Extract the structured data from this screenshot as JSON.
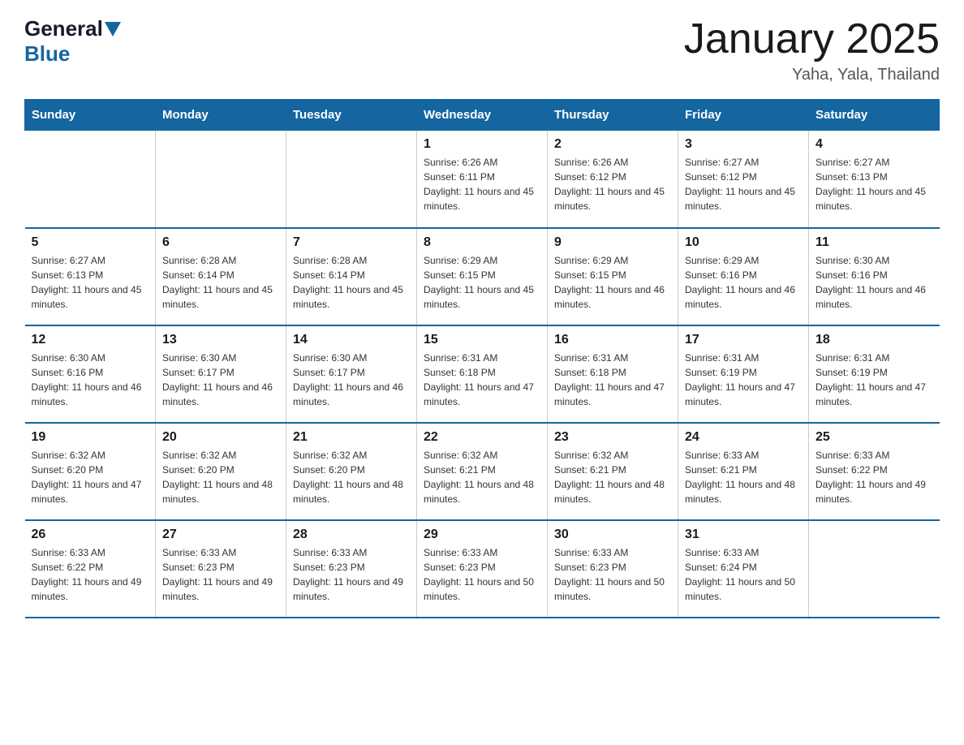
{
  "header": {
    "logo_general": "General",
    "logo_blue": "Blue",
    "month_title": "January 2025",
    "subtitle": "Yaha, Yala, Thailand"
  },
  "days_of_week": [
    "Sunday",
    "Monday",
    "Tuesday",
    "Wednesday",
    "Thursday",
    "Friday",
    "Saturday"
  ],
  "weeks": [
    [
      {
        "num": "",
        "info": ""
      },
      {
        "num": "",
        "info": ""
      },
      {
        "num": "",
        "info": ""
      },
      {
        "num": "1",
        "info": "Sunrise: 6:26 AM\nSunset: 6:11 PM\nDaylight: 11 hours and 45 minutes."
      },
      {
        "num": "2",
        "info": "Sunrise: 6:26 AM\nSunset: 6:12 PM\nDaylight: 11 hours and 45 minutes."
      },
      {
        "num": "3",
        "info": "Sunrise: 6:27 AM\nSunset: 6:12 PM\nDaylight: 11 hours and 45 minutes."
      },
      {
        "num": "4",
        "info": "Sunrise: 6:27 AM\nSunset: 6:13 PM\nDaylight: 11 hours and 45 minutes."
      }
    ],
    [
      {
        "num": "5",
        "info": "Sunrise: 6:27 AM\nSunset: 6:13 PM\nDaylight: 11 hours and 45 minutes."
      },
      {
        "num": "6",
        "info": "Sunrise: 6:28 AM\nSunset: 6:14 PM\nDaylight: 11 hours and 45 minutes."
      },
      {
        "num": "7",
        "info": "Sunrise: 6:28 AM\nSunset: 6:14 PM\nDaylight: 11 hours and 45 minutes."
      },
      {
        "num": "8",
        "info": "Sunrise: 6:29 AM\nSunset: 6:15 PM\nDaylight: 11 hours and 45 minutes."
      },
      {
        "num": "9",
        "info": "Sunrise: 6:29 AM\nSunset: 6:15 PM\nDaylight: 11 hours and 46 minutes."
      },
      {
        "num": "10",
        "info": "Sunrise: 6:29 AM\nSunset: 6:16 PM\nDaylight: 11 hours and 46 minutes."
      },
      {
        "num": "11",
        "info": "Sunrise: 6:30 AM\nSunset: 6:16 PM\nDaylight: 11 hours and 46 minutes."
      }
    ],
    [
      {
        "num": "12",
        "info": "Sunrise: 6:30 AM\nSunset: 6:16 PM\nDaylight: 11 hours and 46 minutes."
      },
      {
        "num": "13",
        "info": "Sunrise: 6:30 AM\nSunset: 6:17 PM\nDaylight: 11 hours and 46 minutes."
      },
      {
        "num": "14",
        "info": "Sunrise: 6:30 AM\nSunset: 6:17 PM\nDaylight: 11 hours and 46 minutes."
      },
      {
        "num": "15",
        "info": "Sunrise: 6:31 AM\nSunset: 6:18 PM\nDaylight: 11 hours and 47 minutes."
      },
      {
        "num": "16",
        "info": "Sunrise: 6:31 AM\nSunset: 6:18 PM\nDaylight: 11 hours and 47 minutes."
      },
      {
        "num": "17",
        "info": "Sunrise: 6:31 AM\nSunset: 6:19 PM\nDaylight: 11 hours and 47 minutes."
      },
      {
        "num": "18",
        "info": "Sunrise: 6:31 AM\nSunset: 6:19 PM\nDaylight: 11 hours and 47 minutes."
      }
    ],
    [
      {
        "num": "19",
        "info": "Sunrise: 6:32 AM\nSunset: 6:20 PM\nDaylight: 11 hours and 47 minutes."
      },
      {
        "num": "20",
        "info": "Sunrise: 6:32 AM\nSunset: 6:20 PM\nDaylight: 11 hours and 48 minutes."
      },
      {
        "num": "21",
        "info": "Sunrise: 6:32 AM\nSunset: 6:20 PM\nDaylight: 11 hours and 48 minutes."
      },
      {
        "num": "22",
        "info": "Sunrise: 6:32 AM\nSunset: 6:21 PM\nDaylight: 11 hours and 48 minutes."
      },
      {
        "num": "23",
        "info": "Sunrise: 6:32 AM\nSunset: 6:21 PM\nDaylight: 11 hours and 48 minutes."
      },
      {
        "num": "24",
        "info": "Sunrise: 6:33 AM\nSunset: 6:21 PM\nDaylight: 11 hours and 48 minutes."
      },
      {
        "num": "25",
        "info": "Sunrise: 6:33 AM\nSunset: 6:22 PM\nDaylight: 11 hours and 49 minutes."
      }
    ],
    [
      {
        "num": "26",
        "info": "Sunrise: 6:33 AM\nSunset: 6:22 PM\nDaylight: 11 hours and 49 minutes."
      },
      {
        "num": "27",
        "info": "Sunrise: 6:33 AM\nSunset: 6:23 PM\nDaylight: 11 hours and 49 minutes."
      },
      {
        "num": "28",
        "info": "Sunrise: 6:33 AM\nSunset: 6:23 PM\nDaylight: 11 hours and 49 minutes."
      },
      {
        "num": "29",
        "info": "Sunrise: 6:33 AM\nSunset: 6:23 PM\nDaylight: 11 hours and 50 minutes."
      },
      {
        "num": "30",
        "info": "Sunrise: 6:33 AM\nSunset: 6:23 PM\nDaylight: 11 hours and 50 minutes."
      },
      {
        "num": "31",
        "info": "Sunrise: 6:33 AM\nSunset: 6:24 PM\nDaylight: 11 hours and 50 minutes."
      },
      {
        "num": "",
        "info": ""
      }
    ]
  ]
}
